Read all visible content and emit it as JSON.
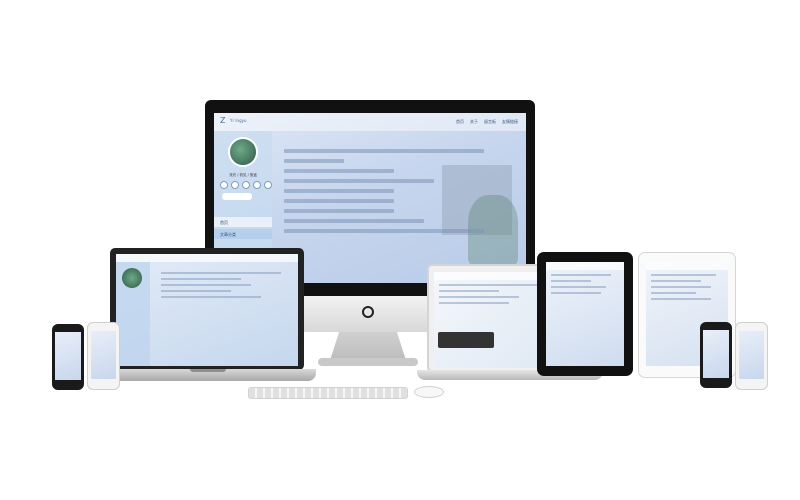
{
  "site": {
    "logo_glyph": "Z",
    "logo_text": "Yr Ingyu",
    "nav": [
      "首页",
      "关于",
      "留言板",
      "友情链接"
    ]
  },
  "sidebar": {
    "name": "流光 / 初见 / 旅途",
    "menu": [
      "首页",
      "文章分类"
    ]
  }
}
